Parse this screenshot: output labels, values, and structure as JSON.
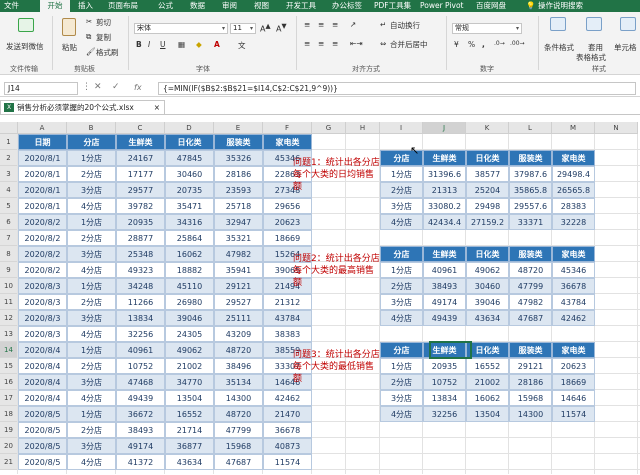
{
  "tabs": [
    "文件",
    "开始",
    "插入",
    "页面布局",
    "公式",
    "数据",
    "审阅",
    "视图",
    "开发工具",
    "办公标签",
    "PDF工具集",
    "Power Pivot",
    "百度网盘"
  ],
  "tell_me": "操作说明搜索",
  "ribbon": {
    "send_wechat": "发送到微信",
    "file_transfer": "文件传输",
    "paste": "粘贴",
    "cut": "剪切",
    "copy": "复制",
    "format_painter": "格式刷",
    "clipboard": "剪贴板",
    "font_name": "宋体",
    "font_size": "11",
    "font_group": "字体",
    "wrap_text": "自动换行",
    "merge_center": "合并后居中",
    "alignment": "对齐方式",
    "number_format": "常规",
    "number": "数字",
    "conditional": "条件格式",
    "table_format_1": "套用",
    "table_format_2": "表格格式",
    "cell_style": "单元格",
    "styles": "样式"
  },
  "formula_bar": {
    "name_box": "J14",
    "fx": "fx",
    "formula": "{=MIN(IF($B$2:$B$21=$I14,C$2:C$21,9^9))}"
  },
  "workbook": {
    "tab": "销售分析必须掌握的20个公式.xlsx",
    "close": "×"
  },
  "columns": [
    "A",
    "B",
    "C",
    "D",
    "E",
    "F",
    "G",
    "H",
    "I",
    "J",
    "K",
    "L",
    "M",
    "N"
  ],
  "rows": [
    "1",
    "2",
    "3",
    "4",
    "5",
    "6",
    "7",
    "8",
    "9",
    "10",
    "11",
    "12",
    "13",
    "14",
    "15",
    "16",
    "17",
    "18",
    "19",
    "20",
    "21"
  ],
  "main": {
    "headers": [
      "日期",
      "分店",
      "生鲜类",
      "日化类",
      "服装类",
      "家电类"
    ],
    "rows": [
      [
        "2020/8/1",
        "1分店",
        "24167",
        "47845",
        "35326",
        "45346"
      ],
      [
        "2020/8/1",
        "2分店",
        "17177",
        "30460",
        "28186",
        "22863"
      ],
      [
        "2020/8/1",
        "3分店",
        "29577",
        "20735",
        "23593",
        "27348"
      ],
      [
        "2020/8/1",
        "4分店",
        "39782",
        "35471",
        "25718",
        "29656"
      ],
      [
        "2020/8/2",
        "1分店",
        "20935",
        "34316",
        "32947",
        "20623"
      ],
      [
        "2020/8/2",
        "2分店",
        "28877",
        "25864",
        "35321",
        "18669"
      ],
      [
        "2020/8/2",
        "3分店",
        "25348",
        "16062",
        "47982",
        "15264"
      ],
      [
        "2020/8/2",
        "4分店",
        "49323",
        "18882",
        "35941",
        "39065"
      ],
      [
        "2020/8/3",
        "1分店",
        "34248",
        "45110",
        "29121",
        "21494"
      ],
      [
        "2020/8/3",
        "2分店",
        "11266",
        "26980",
        "29527",
        "21312"
      ],
      [
        "2020/8/3",
        "3分店",
        "13834",
        "39046",
        "25111",
        "43784"
      ],
      [
        "2020/8/3",
        "4分店",
        "32256",
        "24305",
        "43209",
        "38383"
      ],
      [
        "2020/8/4",
        "1分店",
        "40961",
        "49062",
        "48720",
        "38559"
      ],
      [
        "2020/8/4",
        "2分店",
        "10752",
        "21002",
        "38496",
        "33307"
      ],
      [
        "2020/8/4",
        "3分店",
        "47468",
        "34770",
        "35134",
        "14646"
      ],
      [
        "2020/8/4",
        "4分店",
        "49439",
        "13504",
        "14300",
        "42462"
      ],
      [
        "2020/8/5",
        "1分店",
        "36672",
        "16552",
        "48720",
        "21470"
      ],
      [
        "2020/8/5",
        "2分店",
        "38493",
        "21714",
        "47799",
        "36678"
      ],
      [
        "2020/8/5",
        "3分店",
        "49174",
        "36877",
        "15968",
        "40873"
      ],
      [
        "2020/8/5",
        "4分店",
        "41372",
        "43634",
        "47687",
        "11574"
      ]
    ]
  },
  "questions": [
    "问题1：统计出各分店每个大类的日均销售额",
    "问题2：统计出各分店每个大类的最高销售额",
    "问题3：统计出各分店每个大类的最低销售额"
  ],
  "summary": [
    {
      "headers": [
        "分店",
        "生鲜类",
        "日化类",
        "服装类",
        "家电类"
      ],
      "rows": [
        [
          "1分店",
          "31396.6",
          "38577",
          "37987.6",
          "29498.4"
        ],
        [
          "2分店",
          "21313",
          "25204",
          "35865.8",
          "26565.8"
        ],
        [
          "3分店",
          "33080.2",
          "29498",
          "29557.6",
          "28383"
        ],
        [
          "4分店",
          "42434.4",
          "27159.2",
          "33371",
          "32228"
        ]
      ]
    },
    {
      "headers": [
        "分店",
        "生鲜类",
        "日化类",
        "服装类",
        "家电类"
      ],
      "rows": [
        [
          "1分店",
          "40961",
          "49062",
          "48720",
          "45346"
        ],
        [
          "2分店",
          "38493",
          "30460",
          "47799",
          "36678"
        ],
        [
          "3分店",
          "49174",
          "39046",
          "47982",
          "43784"
        ],
        [
          "4分店",
          "49439",
          "43634",
          "47687",
          "42462"
        ]
      ]
    },
    {
      "headers": [
        "分店",
        "生鲜类",
        "日化类",
        "服装类",
        "家电类"
      ],
      "rows": [
        [
          "1分店",
          "20935",
          "16552",
          "29121",
          "20623"
        ],
        [
          "2分店",
          "10752",
          "21002",
          "28186",
          "18669"
        ],
        [
          "3分店",
          "13834",
          "16062",
          "15968",
          "14646"
        ],
        [
          "4分店",
          "32256",
          "13504",
          "14300",
          "11574"
        ]
      ]
    }
  ]
}
